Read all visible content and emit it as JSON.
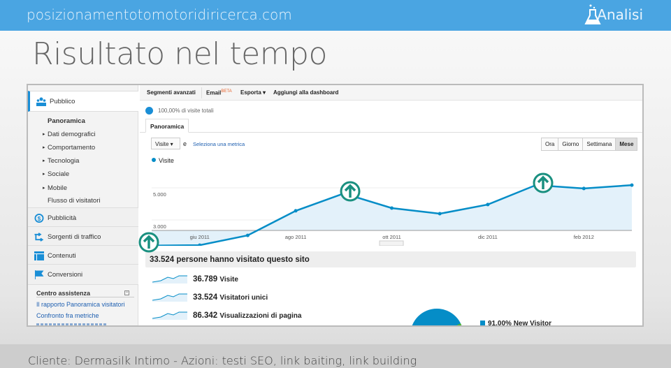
{
  "header": {
    "site": "posizionamentotomotoridiricerca.com",
    "section": "Analisi",
    "section_icon": "flask-icon",
    "color": "#4aa5e2"
  },
  "title": "Risultato nel tempo",
  "sidebar": {
    "pubblico": "Pubblico",
    "items": [
      {
        "label": "Panoramica",
        "bold": true
      },
      {
        "label": "Dati demografici",
        "arrow": true
      },
      {
        "label": "Comportamento",
        "arrow": true
      },
      {
        "label": "Tecnologia",
        "arrow": true
      },
      {
        "label": "Sociale",
        "arrow": true
      },
      {
        "label": "Mobile",
        "arrow": true
      },
      {
        "label": "Flusso di visitatori"
      }
    ],
    "sections": [
      "Pubblicità",
      "Sorgenti di traffico",
      "Contenuti",
      "Conversioni"
    ],
    "help_title": "Centro assistenza",
    "help_links": [
      "Il rapporto Panoramica visitatori",
      "Confronto fra metriche"
    ]
  },
  "toolbar": {
    "segments": "Segmenti avanzati",
    "email": "Email",
    "beta": "BETA",
    "export": "Esporta ▾",
    "add_dashboard": "Aggiungi alla dashboard"
  },
  "segment": "100,00% di visite totali",
  "tab": "Panoramica",
  "metric_select": "Visite",
  "and": "e",
  "select_metric": "Seleziona una metrica",
  "periods": [
    "Ora",
    "Giorno",
    "Settimana",
    "Mese"
  ],
  "active_period": "Mese",
  "chart_data": {
    "type": "area",
    "legend": "Visite",
    "color": "#058dc7",
    "x": [
      "mag 2011",
      "giu 2011",
      "lug 2011",
      "ago 2011",
      "set 2011",
      "ott 2011",
      "nov 2011",
      "dic 2011",
      "gen 2012",
      "feb 2012",
      "mar 2012"
    ],
    "x_tick_labels": [
      "giu 2011",
      "ago 2011",
      "ott 2011",
      "dic 2011",
      "feb 2012"
    ],
    "y_tick_labels": [
      "5.000",
      "3.000"
    ],
    "values": [
      1400,
      1430,
      2040,
      3570,
      4650,
      3740,
      3390,
      3960,
      5170,
      4960,
      5170
    ],
    "grid": true
  },
  "annotations_icon": "arrow-up-circle-icon",
  "summary": "33.524 persone hanno visitato questo sito",
  "metrics": [
    {
      "value": "36.789",
      "label": "Visite"
    },
    {
      "value": "33.524",
      "label": "Visitatori unici"
    },
    {
      "value": "86.342",
      "label": "Visualizzazioni di pagina"
    }
  ],
  "pie_legend": "91,00% New Visitor",
  "footer": "Cliente: Dermasilk Intimo - Azioni: testi SEO, link baiting, link building"
}
